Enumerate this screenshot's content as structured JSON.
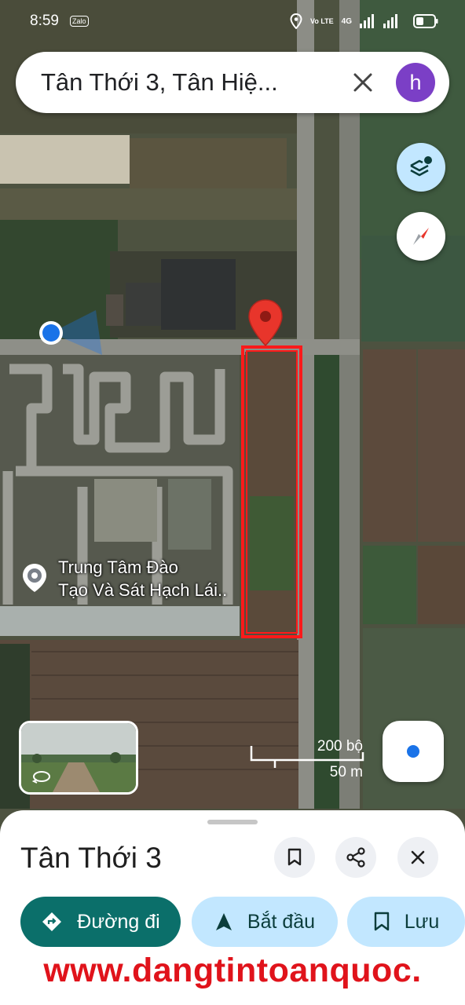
{
  "status_bar": {
    "time": "8:59",
    "notification_app": "Zalo",
    "volte": "Vo LTE",
    "network": "4G",
    "icons": [
      "location-icon",
      "signal-icon",
      "battery-icon"
    ]
  },
  "search": {
    "query": "Tân Thới 3, Tân Hiệ...",
    "avatar_letter": "h"
  },
  "map": {
    "place_label_line1": "Trung Tâm Đào",
    "place_label_line2": "Tạo Và Sát Hạch Lái..",
    "pin_color": "#e8352b",
    "highlight_color": "#ff1a1a",
    "my_location_color": "#1a73e8"
  },
  "scale": {
    "imperial": "200 bộ",
    "metric": "50 m"
  },
  "sheet": {
    "title": "Tân Thới 3",
    "directions_label": "Đường đi",
    "start_label": "Bắt đầu",
    "save_label": "Lưu"
  },
  "watermark": "www.dangtintoanquoc.",
  "colors": {
    "accent_teal": "#0b6f6a",
    "chip_light": "#c2e7ff",
    "avatar": "#7b3fc6"
  }
}
